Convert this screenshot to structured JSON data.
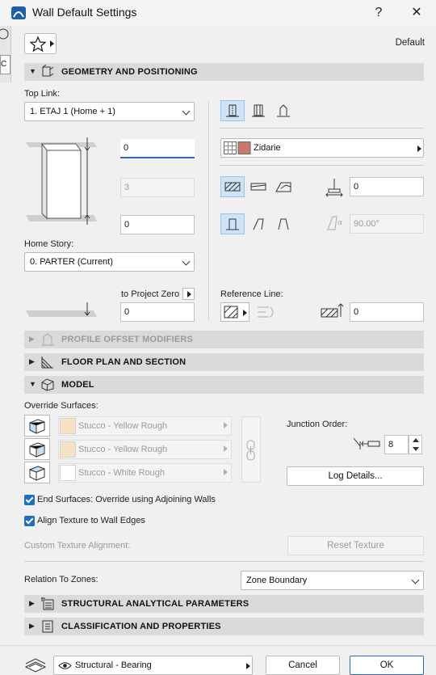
{
  "window": {
    "title": "Wall Default Settings",
    "help": "?",
    "close": "✕"
  },
  "app_strip": {
    "letter": "C"
  },
  "favorites": {
    "default_label": "Default"
  },
  "sections": {
    "geometry": "GEOMETRY AND POSITIONING",
    "profile": "PROFILE OFFSET MODIFIERS",
    "floor_plan": "FLOOR PLAN AND SECTION",
    "model": "MODEL",
    "structural": "STRUCTURAL ANALYTICAL PARAMETERS",
    "classification": "CLASSIFICATION AND PROPERTIES"
  },
  "geometry": {
    "top_link_label": "Top Link:",
    "top_link_value": "1. ETAJ 1 (Home + 1)",
    "top_offset": "0",
    "height": "3",
    "bottom_offset": "0",
    "home_story_label": "Home Story:",
    "home_story_value": "0. PARTER (Current)",
    "to_project_zero_label": "to Project Zero",
    "to_project_zero_value": "0",
    "material": "Zidarie",
    "thickness": "0",
    "angle": "90.00°",
    "reference_line_label": "Reference Line:",
    "reference_offset": "0"
  },
  "model": {
    "override_surfaces_label": "Override Surfaces:",
    "surfaces": [
      {
        "name": "Stucco - Yellow Rough",
        "color": "#f6e2c2"
      },
      {
        "name": "Stucco - Yellow Rough",
        "color": "#f6e2c2"
      },
      {
        "name": "Stucco - White Rough",
        "color": "#ffffff"
      }
    ],
    "junction_order_label": "Junction Order:",
    "junction_order_value": "8",
    "log_details": "Log Details...",
    "end_surfaces_label": "End Surfaces: Override using Adjoining Walls",
    "align_texture_label": "Align Texture to Wall Edges",
    "custom_texture_label": "Custom Texture Alignment:",
    "reset_texture": "Reset Texture"
  },
  "zones": {
    "label": "Relation To Zones:",
    "value": "Zone Boundary"
  },
  "footer": {
    "layer": "Structural - Bearing",
    "cancel": "Cancel",
    "ok": "OK"
  },
  "colors": {
    "accent": "#2b6cb0",
    "selected_bg": "#cfe3f7",
    "material_swatch": "#c9786c"
  }
}
